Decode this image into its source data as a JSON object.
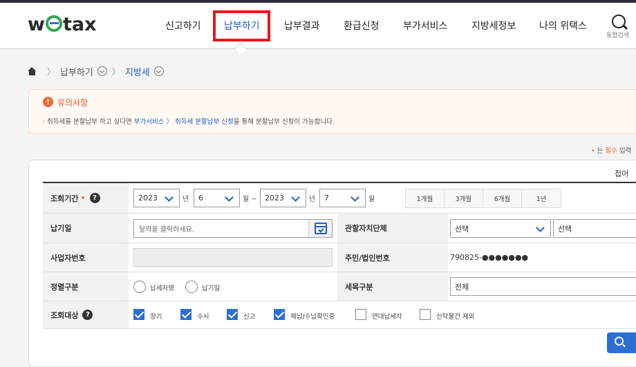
{
  "header": {
    "logo": {
      "pre": "w",
      "post": "tax"
    },
    "nav": [
      {
        "label": "신고하기"
      },
      {
        "label": "납부하기"
      },
      {
        "label": "납부결과"
      },
      {
        "label": "환급신청"
      },
      {
        "label": "부가서비스"
      },
      {
        "label": "지방세정보"
      },
      {
        "label": "나의 위택스"
      }
    ],
    "search_label": "통합검색"
  },
  "breadcrumb": {
    "level1": "납부하기",
    "level2": "지방세"
  },
  "notice": {
    "title": "유의사항",
    "text_before": "· 취득세를 분할납부 하고 싶다면 ",
    "text_link": "부가서비스 〉 취득세 분할납부 신청",
    "text_after": "을 통해 분할납부 신청이 가능합니다."
  },
  "required_note": {
    "prefix": "는 ",
    "mark": "필수",
    "suffix": " 입력"
  },
  "panel": {
    "fold_label": "접어",
    "period": {
      "label": "조회기간",
      "start_year": "2023",
      "start_month": "6",
      "end_year": "2023",
      "end_month": "7",
      "unit_year": "년",
      "unit_month_tilde": "월 ~",
      "unit_month": "월",
      "quick": [
        "1개월",
        "3개월",
        "6개월",
        "1년"
      ]
    },
    "due_date": {
      "label": "납기일",
      "placeholder": "달력을 클릭하세요."
    },
    "authority": {
      "label": "관할자치단체",
      "select1": "선택",
      "select2": "선택"
    },
    "biz_no": {
      "label": "사업자번호",
      "value": ""
    },
    "resident_no": {
      "label": "주민/법인번호",
      "value": "790825-●●●●●●●"
    },
    "sort": {
      "label": "정렬구분",
      "options": [
        "납세자명",
        "납기일"
      ]
    },
    "tax_item": {
      "label": "세목구분",
      "value": "전체"
    },
    "target": {
      "label": "조회대상",
      "options": [
        {
          "label": "정기",
          "checked": true
        },
        {
          "label": "수시",
          "checked": true
        },
        {
          "label": "신고",
          "checked": true
        },
        {
          "label": "체납/수납확인중",
          "checked": true
        },
        {
          "label": "연대납세자",
          "checked": false
        },
        {
          "label": "신탁물건 제외",
          "checked": false
        }
      ]
    }
  },
  "colors": {
    "accent": "#1d5fc8",
    "highlight": "#e8161b",
    "warning": "#ee6a2a",
    "checkbox": "#2a6fd6"
  }
}
